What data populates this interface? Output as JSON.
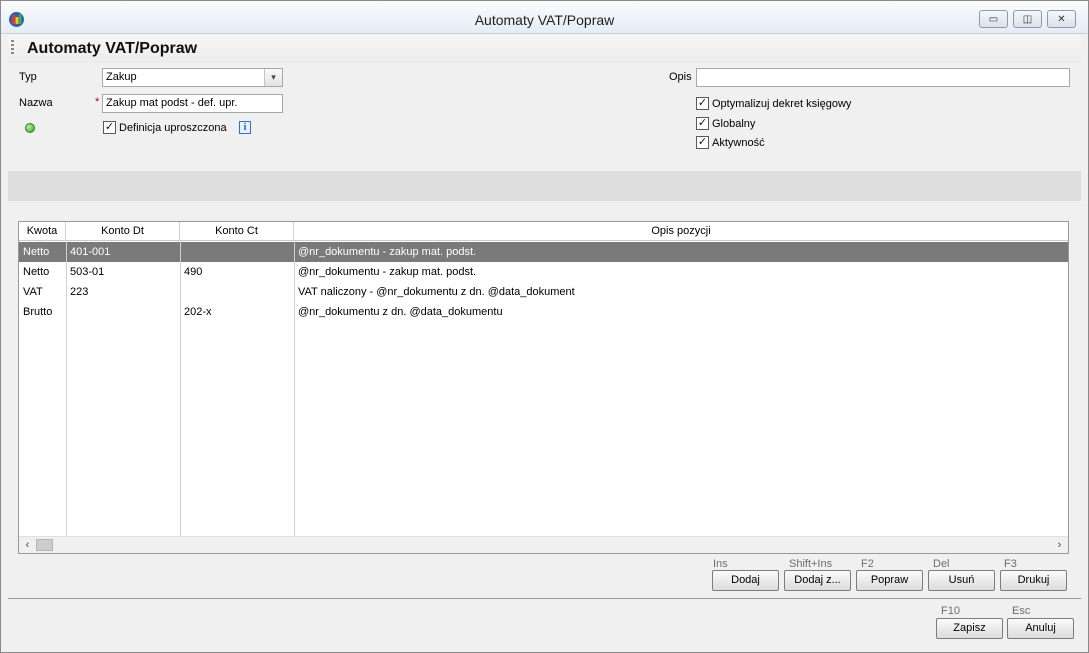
{
  "window": {
    "title": "Automaty VAT/Popraw",
    "min_glyph": "▭",
    "max_glyph": "◫",
    "close_glyph": "✕"
  },
  "header": {
    "title": "Automaty VAT/Popraw"
  },
  "form": {
    "typ_label": "Typ",
    "typ_value": "Zakup",
    "nazwa_label": "Nazwa",
    "required_mark": "*",
    "nazwa_value": "Zakup mat podst - def. upr.",
    "definicja_label": "Definicja uproszczona",
    "definicja_checked": true,
    "info_glyph": "i",
    "opis_label": "Opis",
    "opis_value": "",
    "options": [
      {
        "label": "Optymalizuj dekret księgowy",
        "checked": true
      },
      {
        "label": "Globalny",
        "checked": true
      },
      {
        "label": "Aktywność",
        "checked": true
      }
    ],
    "check_glyph": "✓",
    "combo_arrow": "▾"
  },
  "grid": {
    "columns": [
      "Kwota",
      "Konto Dt",
      "Konto Ct",
      "Opis pozycji"
    ],
    "rows": [
      {
        "kwota": "Netto",
        "konto_dt": "401-001",
        "konto_ct": "",
        "opis": "@nr_dokumentu - zakup mat. podst.",
        "selected": true
      },
      {
        "kwota": "Netto",
        "konto_dt": "503-01",
        "konto_ct": "490",
        "opis": "@nr_dokumentu - zakup mat. podst.",
        "selected": false
      },
      {
        "kwota": "VAT",
        "konto_dt": "223",
        "konto_ct": "",
        "opis": "VAT naliczony - @nr_dokumentu z dn. @data_dokument",
        "selected": false
      },
      {
        "kwota": "Brutto",
        "konto_dt": "",
        "konto_ct": "202-x",
        "opis": "@nr_dokumentu z dn. @data_dokumentu",
        "selected": false
      }
    ],
    "scroll_left": "‹",
    "scroll_right": "›"
  },
  "actions": {
    "dodaj": {
      "shortcut": "Ins",
      "label": "Dodaj"
    },
    "dodaj_z": {
      "shortcut": "Shift+Ins",
      "label": "Dodaj z..."
    },
    "popraw": {
      "shortcut": "F2",
      "label": "Popraw"
    },
    "usun": {
      "shortcut": "Del",
      "label": "Usuń"
    },
    "drukuj": {
      "shortcut": "F3",
      "label": "Drukuj"
    },
    "zapisz": {
      "shortcut": "F10",
      "label": "Zapisz"
    },
    "anuluj": {
      "shortcut": "Esc",
      "label": "Anuluj"
    }
  }
}
